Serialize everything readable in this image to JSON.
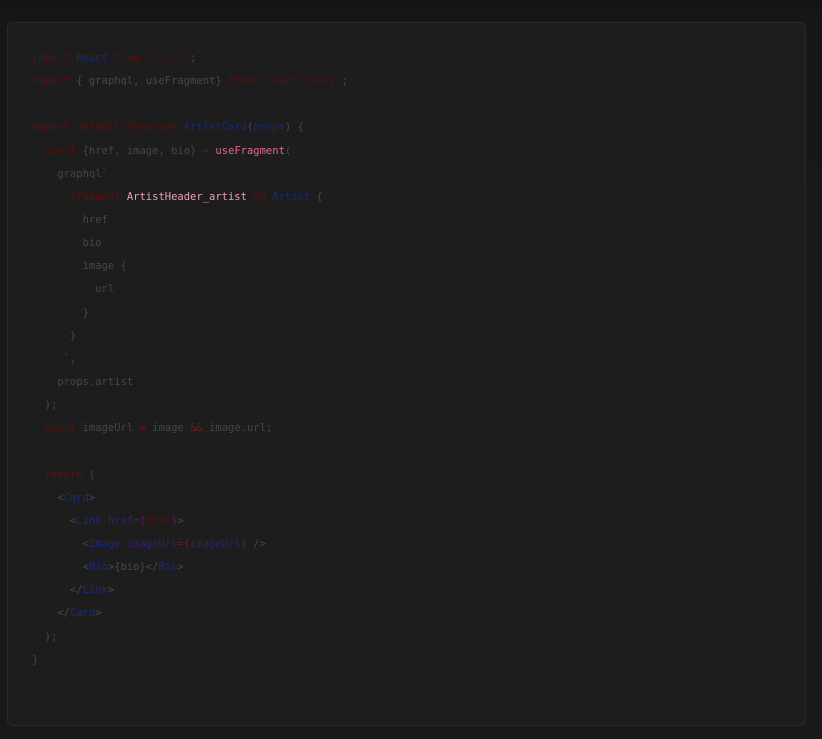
{
  "code": {
    "lines": [
      [
        {
          "t": "import",
          "c": "kw"
        },
        {
          "t": " ",
          "c": "punct"
        },
        {
          "t": "React",
          "c": "id"
        },
        {
          "t": " ",
          "c": "punct"
        },
        {
          "t": "from",
          "c": "kw"
        },
        {
          "t": " ",
          "c": "punct"
        },
        {
          "t": "'react'",
          "c": "str"
        },
        {
          "t": ";",
          "c": "punct"
        }
      ],
      [
        {
          "t": "import",
          "c": "kw"
        },
        {
          "t": " { graphql, useFragment} ",
          "c": "punct"
        },
        {
          "t": "from",
          "c": "kw"
        },
        {
          "t": " ",
          "c": "punct"
        },
        {
          "t": "'react-relay'",
          "c": "str"
        },
        {
          "t": ";",
          "c": "punct"
        }
      ],
      [],
      [
        {
          "t": "export",
          "c": "kw"
        },
        {
          "t": " ",
          "c": "punct"
        },
        {
          "t": "default",
          "c": "kw"
        },
        {
          "t": " ",
          "c": "punct"
        },
        {
          "t": "function",
          "c": "kw"
        },
        {
          "t": " ",
          "c": "punct"
        },
        {
          "t": "ArtistCard",
          "c": "id"
        },
        {
          "t": "(",
          "c": "punct"
        },
        {
          "t": "props",
          "c": "id"
        },
        {
          "t": ") {",
          "c": "punct"
        }
      ],
      [
        {
          "t": "  ",
          "c": "punct"
        },
        {
          "t": "const",
          "c": "kw"
        },
        {
          "t": " {href, image, bio} ",
          "c": "ident"
        },
        {
          "t": "=",
          "c": "op"
        },
        {
          "t": " ",
          "c": "punct"
        },
        {
          "t": "useFragment",
          "c": "fn"
        },
        {
          "t": "(",
          "c": "punct"
        }
      ],
      [
        {
          "t": "    graphql`",
          "c": "ident"
        }
      ],
      [
        {
          "t": "      ",
          "c": "punct"
        },
        {
          "t": "fragment",
          "c": "kw"
        },
        {
          "t": " ",
          "c": "punct"
        },
        {
          "t": "ArtistHeader_artist",
          "c": "frag"
        },
        {
          "t": " ",
          "c": "punct"
        },
        {
          "t": "on",
          "c": "kw"
        },
        {
          "t": " ",
          "c": "punct"
        },
        {
          "t": "Artist",
          "c": "id"
        },
        {
          "t": " {",
          "c": "punct"
        }
      ],
      [
        {
          "t": "        href",
          "c": "ident"
        }
      ],
      [
        {
          "t": "        bio",
          "c": "ident"
        }
      ],
      [
        {
          "t": "        image {",
          "c": "ident"
        }
      ],
      [
        {
          "t": "          url",
          "c": "ident"
        }
      ],
      [
        {
          "t": "        }",
          "c": "punct"
        }
      ],
      [
        {
          "t": "      }",
          "c": "punct"
        }
      ],
      [
        {
          "t": "     `,",
          "c": "punct"
        }
      ],
      [
        {
          "t": "    props.artist",
          "c": "ident"
        }
      ],
      [
        {
          "t": "  );",
          "c": "punct"
        }
      ],
      [
        {
          "t": "  ",
          "c": "punct"
        },
        {
          "t": "const",
          "c": "kw"
        },
        {
          "t": " imageUrl ",
          "c": "ident"
        },
        {
          "t": "=",
          "c": "op"
        },
        {
          "t": " image ",
          "c": "ident"
        },
        {
          "t": "&&",
          "c": "op"
        },
        {
          "t": " image.url;",
          "c": "ident"
        }
      ],
      [],
      [
        {
          "t": "  ",
          "c": "punct"
        },
        {
          "t": "return",
          "c": "kw"
        },
        {
          "t": " (",
          "c": "punct"
        }
      ],
      [
        {
          "t": "    <",
          "c": "punct"
        },
        {
          "t": "Card",
          "c": "tag"
        },
        {
          "t": ">",
          "c": "punct"
        }
      ],
      [
        {
          "t": "      <",
          "c": "punct"
        },
        {
          "t": "Link",
          "c": "tag"
        },
        {
          "t": " ",
          "c": "punct"
        },
        {
          "t": "href",
          "c": "attr"
        },
        {
          "t": "=",
          "c": "op"
        },
        {
          "t": "{",
          "c": "brace"
        },
        {
          "t": "href",
          "c": "kw"
        },
        {
          "t": "}",
          "c": "brace"
        },
        {
          "t": ">",
          "c": "punct"
        }
      ],
      [
        {
          "t": "        <",
          "c": "punct"
        },
        {
          "t": "Image",
          "c": "tag"
        },
        {
          "t": " ",
          "c": "punct"
        },
        {
          "t": "imageUrl",
          "c": "attr"
        },
        {
          "t": "=",
          "c": "op"
        },
        {
          "t": "{",
          "c": "brace"
        },
        {
          "t": "imageUrl",
          "c": "attr"
        },
        {
          "t": "}",
          "c": "brace"
        },
        {
          "t": " />",
          "c": "punct"
        }
      ],
      [
        {
          "t": "        <",
          "c": "punct"
        },
        {
          "t": "Bio",
          "c": "tag"
        },
        {
          "t": ">{bio}</",
          "c": "punct"
        },
        {
          "t": "Bio",
          "c": "tag"
        },
        {
          "t": ">",
          "c": "punct"
        }
      ],
      [
        {
          "t": "      </",
          "c": "punct"
        },
        {
          "t": "Link",
          "c": "tag"
        },
        {
          "t": ">",
          "c": "punct"
        }
      ],
      [
        {
          "t": "    </",
          "c": "punct"
        },
        {
          "t": "Card",
          "c": "tag"
        },
        {
          "t": ">",
          "c": "punct"
        }
      ],
      [
        {
          "t": "  );",
          "c": "punct"
        }
      ],
      [
        {
          "t": "}",
          "c": "punct"
        }
      ]
    ]
  },
  "colors": {
    "background": "#151515",
    "card": "#1d1d1d",
    "keyword": "#5a1010",
    "identifier": "#1a2870",
    "function": "#e06a8a",
    "fragment_name": "#e4a0b4",
    "plain_text": "#4a4a4a"
  }
}
